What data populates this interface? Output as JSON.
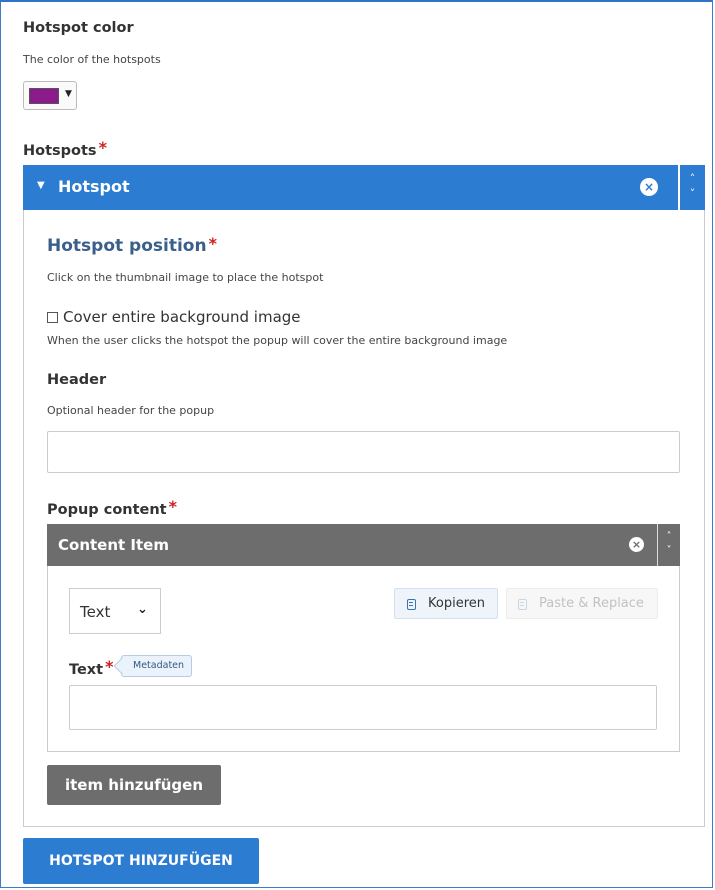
{
  "hotspot_color": {
    "label": "Hotspot color",
    "description": "The color of the hotspots",
    "value": "#8b1a8b",
    "caret": "▼"
  },
  "hotspots": {
    "label": "Hotspots",
    "required_mark": "*",
    "group": {
      "title": "Hotspot",
      "caret": "▼",
      "remove_icon": "×",
      "up": "˄",
      "down": "˅",
      "accent_color": "#2c7cd2"
    },
    "position": {
      "label": "Hotspot position",
      "required_mark": "*",
      "description": "Click on the thumbnail image to place the hotspot"
    },
    "cover": {
      "label": "Cover entire background image",
      "checked": false,
      "description": "When the user clicks the hotspot the popup will cover the entire background image"
    },
    "header": {
      "label": "Header",
      "description": "Optional header for the popup",
      "value": ""
    },
    "popup": {
      "label": "Popup content",
      "required_mark": "*",
      "content_item": {
        "title": "Content Item",
        "remove_icon": "×",
        "up": "˄",
        "down": "˅",
        "type_select": {
          "value": "Text",
          "chevron": "⌄"
        },
        "copy_button": "Kopieren",
        "paste_button": "Paste & Replace",
        "text_field": {
          "label": "Text",
          "required_mark": "*",
          "metadata_tag": "Metadaten",
          "value": ""
        }
      },
      "add_item_button": "item hinzufügen"
    },
    "add_hotspot_button": "HOTSPOT HINZUFÜGEN"
  }
}
